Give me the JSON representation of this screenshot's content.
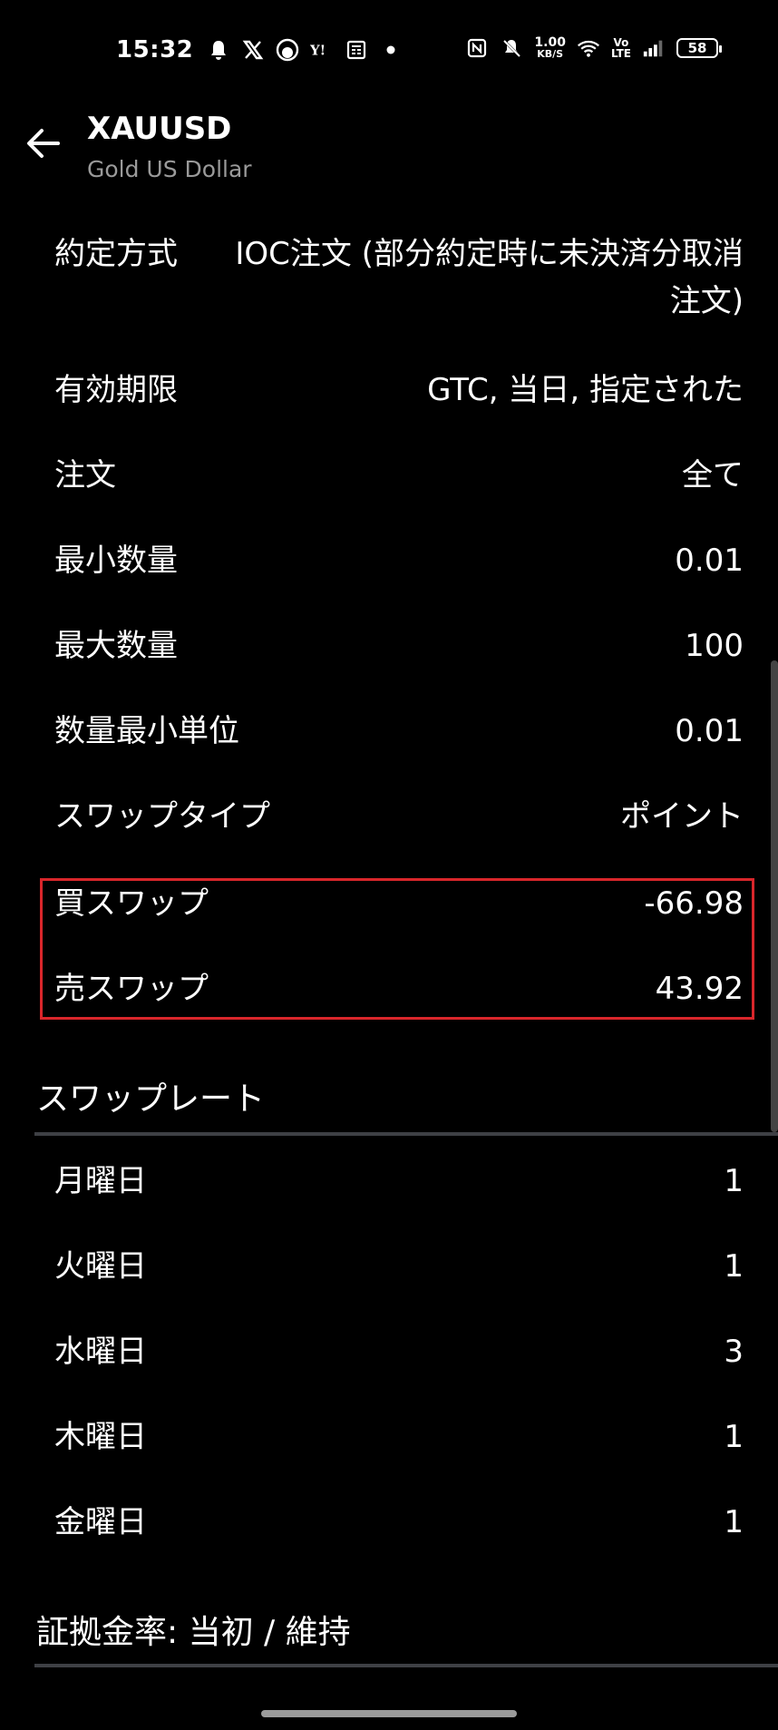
{
  "status_bar": {
    "time": "15:32",
    "speed_value": "1.00",
    "speed_unit": "KB/S",
    "volte_top": "Vo",
    "volte_bottom": "LTE",
    "battery": "58",
    "icons": [
      "bell-icon",
      "x-icon",
      "app-icon",
      "yahoo-icon",
      "news-icon",
      "dot-icon",
      "nfc-icon",
      "mute-icon",
      "wifi-icon",
      "signal-icon"
    ]
  },
  "app_bar": {
    "title": "XAUUSD",
    "subtitle": "Gold US Dollar"
  },
  "specs": [
    {
      "label": "約定方式",
      "value": "IOC注文 (部分約定時に未決済分取消注文)"
    },
    {
      "label": "有効期限",
      "value": "GTC, 当日, 指定された"
    },
    {
      "label": "注文",
      "value": "全て"
    },
    {
      "label": "最小数量",
      "value": "0.01"
    },
    {
      "label": "最大数量",
      "value": "100"
    },
    {
      "label": "数量最小単位",
      "value": "0.01"
    },
    {
      "label": "スワップタイプ",
      "value": "ポイント"
    },
    {
      "label": "買スワップ",
      "value": "-66.98"
    },
    {
      "label": "売スワップ",
      "value": "43.92"
    }
  ],
  "swap_rate": {
    "header": "スワップレート",
    "rows": [
      {
        "label": "月曜日",
        "value": "1"
      },
      {
        "label": "火曜日",
        "value": "1"
      },
      {
        "label": "水曜日",
        "value": "3"
      },
      {
        "label": "木曜日",
        "value": "1"
      },
      {
        "label": "金曜日",
        "value": "1"
      }
    ]
  },
  "margin_section": {
    "header": "証拠金率: 当初 / 維持"
  },
  "colors": {
    "background": "#000000",
    "text": "#ffffff",
    "subtitle": "#9a9a9a",
    "highlight_border": "#d9262b",
    "divider": "#3e4045"
  }
}
